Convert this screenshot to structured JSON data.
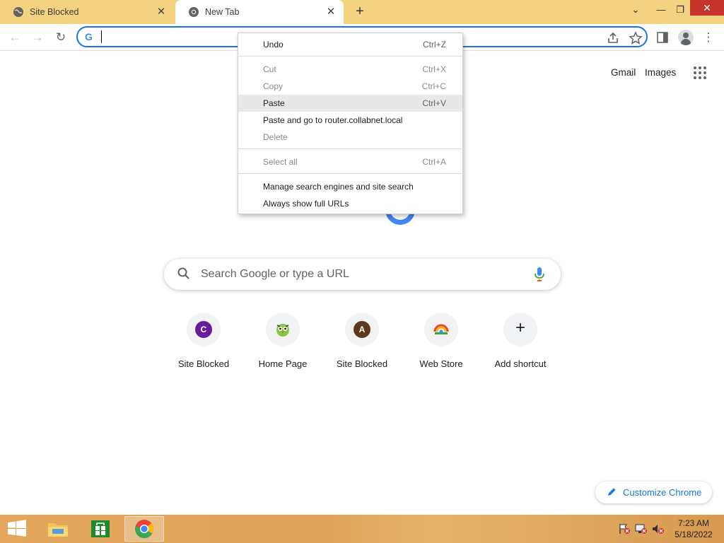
{
  "tabs": [
    {
      "title": "Site Blocked",
      "close": "✕"
    },
    {
      "title": "New Tab",
      "close": "✕"
    }
  ],
  "new_tab_glyph": "+",
  "window_controls": {
    "minimize": "—",
    "restore": "❐",
    "close": "✕",
    "menu": "⌄"
  },
  "toolbar": {
    "back_glyph": "←",
    "forward_glyph": "→",
    "reload_glyph": "↻",
    "omnibox_value": "",
    "more_glyph": "⋮"
  },
  "top_links": {
    "gmail": "Gmail",
    "images": "Images"
  },
  "search": {
    "placeholder": "Search Google or type a URL"
  },
  "shortcuts": [
    {
      "label": "Site Blocked",
      "letter": "C",
      "color": "#6a1b9a"
    },
    {
      "label": "Home Page",
      "letter": "",
      "color": "#8bc34a"
    },
    {
      "label": "Site Blocked",
      "letter": "A",
      "color": "#5d3a1a"
    },
    {
      "label": "Web Store",
      "letter": "",
      "color": "#ffffff"
    },
    {
      "label": "Add shortcut",
      "letter": "+",
      "color": "#f1f3f4"
    }
  ],
  "context_menu": {
    "undo": {
      "label": "Undo",
      "key": "Ctrl+Z"
    },
    "cut": {
      "label": "Cut",
      "key": "Ctrl+X"
    },
    "copy": {
      "label": "Copy",
      "key": "Ctrl+C"
    },
    "paste": {
      "label": "Paste",
      "key": "Ctrl+V"
    },
    "paste_go": {
      "label": "Paste and go to router.collabnet.local"
    },
    "delete": {
      "label": "Delete"
    },
    "select_all": {
      "label": "Select all",
      "key": "Ctrl+A"
    },
    "manage": {
      "label": "Manage search engines and site search"
    },
    "full_urls": {
      "label": "Always show full URLs"
    }
  },
  "customize": {
    "label": "Customize Chrome"
  },
  "clock": {
    "time": "7:23 AM",
    "date": "5/18/2022"
  },
  "colors": {
    "accent": "#1a73e8",
    "titlebar": "#f3d37f",
    "taskbar": "#e3a65b"
  }
}
